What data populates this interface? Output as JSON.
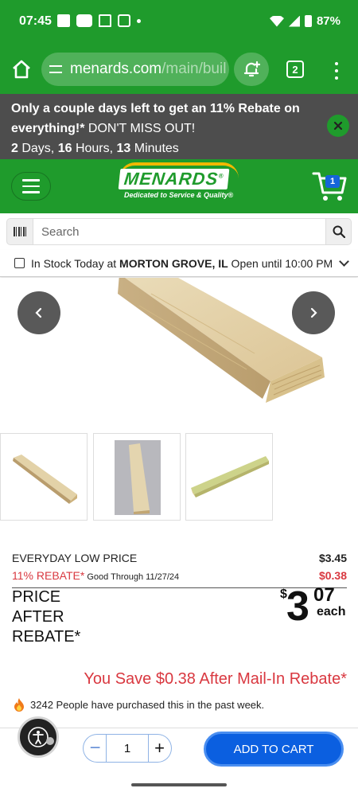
{
  "status_bar": {
    "time": "07:45",
    "battery": "87%"
  },
  "browser": {
    "url_domain": "menards.com",
    "url_path": "/main/buil",
    "tab_count": "2"
  },
  "promo": {
    "line1": "Only a couple days left to get an 11% Rebate on",
    "line2_bold": "everything!*",
    "line2_rest": " DON'T MISS OUT!",
    "days": "2",
    "days_label": " Days, ",
    "hours": "16",
    "hours_label": " Hours, ",
    "minutes": "13",
    "minutes_label": " Minutes"
  },
  "header": {
    "logo_text": "MENARDS",
    "logo_reg": "®",
    "tagline": "Dedicated to Service & Quality®",
    "cart_count": "1"
  },
  "search": {
    "placeholder": "Search"
  },
  "store": {
    "prefix": "In Stock Today at ",
    "name": "MORTON GROVE, IL",
    "hours": " Open until 10:00 PM"
  },
  "price": {
    "everyday_label": "EVERYDAY LOW PRICE",
    "everyday_value": "$3.45",
    "rebate_label": "11% REBATE*",
    "rebate_good_through": " Good Through 11/27/24",
    "rebate_value": "$0.38",
    "after_label_1": "PRICE",
    "after_label_2": "AFTER",
    "after_label_3": "REBATE*",
    "dollar_sign": "$",
    "dollars": "3",
    "cents": "07",
    "unit": "each"
  },
  "savings": {
    "text": "You Save $0.38 After Mail-In Rebate*"
  },
  "social_proof": {
    "text": "3242 People have purchased this in the past week."
  },
  "cart_bar": {
    "quantity": "1",
    "minus": "−",
    "plus": "+",
    "add_label": "ADD TO CART"
  },
  "colors": {
    "brand_green": "#1f9b2c",
    "promo_gray": "#4d4d4d",
    "rebate_red": "#d93840",
    "cart_blue": "#0b5fe0"
  }
}
